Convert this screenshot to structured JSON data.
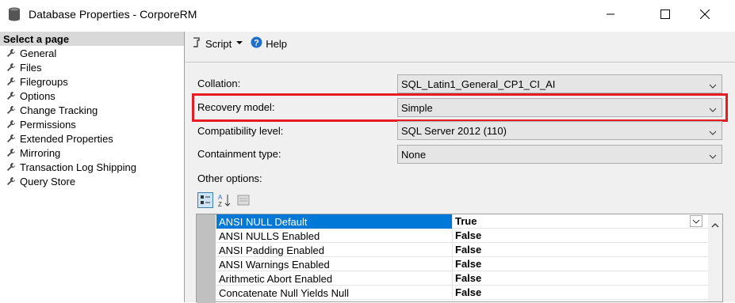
{
  "window": {
    "title": "Database Properties - CorporeRM"
  },
  "left_panel": {
    "header": "Select a page",
    "items": [
      "General",
      "Files",
      "Filegroups",
      "Options",
      "Change Tracking",
      "Permissions",
      "Extended Properties",
      "Mirroring",
      "Transaction Log Shipping",
      "Query Store"
    ]
  },
  "toolbar": {
    "script_label": "Script",
    "help_label": "Help"
  },
  "options": {
    "collation": {
      "label": "Collation:",
      "value": "SQL_Latin1_General_CP1_CI_AI"
    },
    "recovery_model": {
      "label": "Recovery model:",
      "value": "Simple"
    },
    "compatibility_level": {
      "label": "Compatibility level:",
      "value": "SQL Server 2012 (110)"
    },
    "containment_type": {
      "label": "Containment type:",
      "value": "None"
    },
    "other_options_label": "Other options:"
  },
  "grid": {
    "rows": [
      {
        "name": "ANSI NULL Default",
        "value": "True",
        "selected": true
      },
      {
        "name": "ANSI NULLS Enabled",
        "value": "False"
      },
      {
        "name": "ANSI Padding Enabled",
        "value": "False"
      },
      {
        "name": "ANSI Warnings Enabled",
        "value": "False"
      },
      {
        "name": "Arithmetic Abort Enabled",
        "value": "False"
      },
      {
        "name": "Concatenate Null Yields Null",
        "value": "False"
      }
    ]
  },
  "colors": {
    "highlight_border": "#e81b23",
    "selection": "#0078d7"
  }
}
